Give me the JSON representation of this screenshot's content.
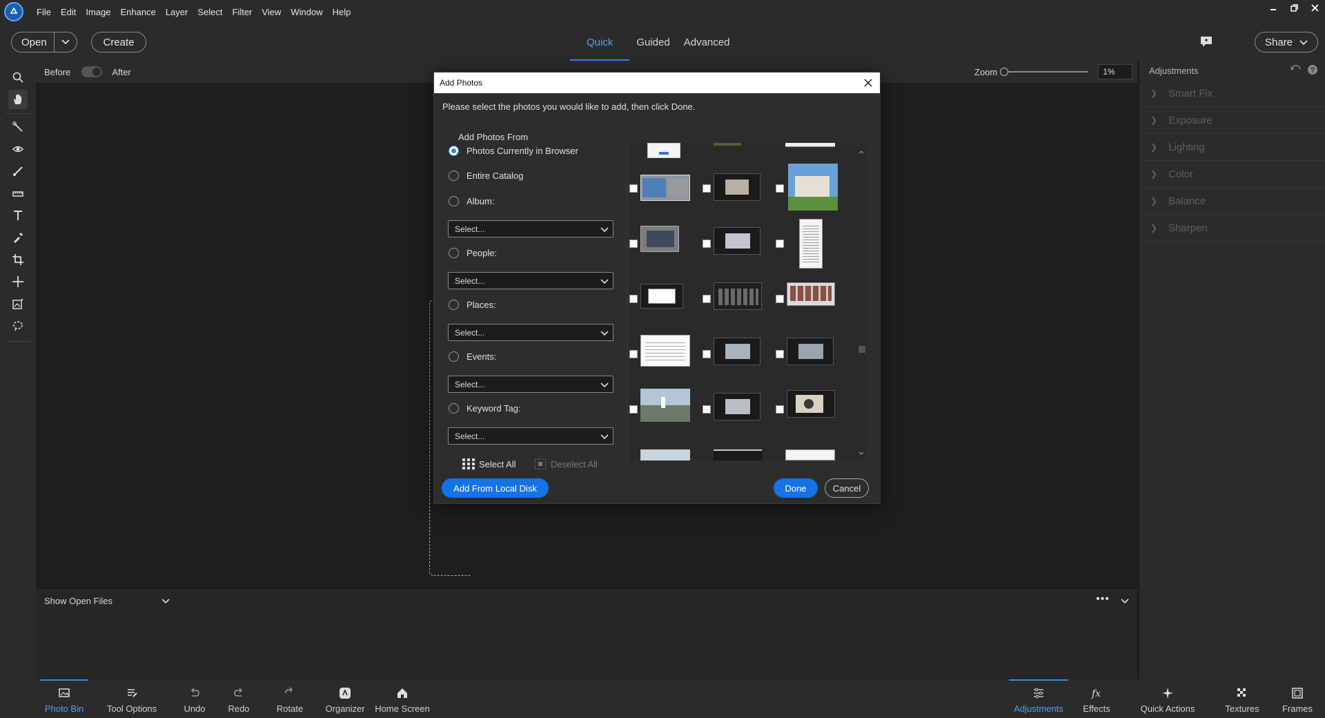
{
  "menubar": {
    "items": [
      "File",
      "Edit",
      "Image",
      "Enhance",
      "Layer",
      "Select",
      "Filter",
      "View",
      "Window",
      "Help"
    ]
  },
  "toolbar": {
    "open_label": "Open",
    "create_label": "Create",
    "tabs": [
      "Quick",
      "Guided",
      "Advanced"
    ],
    "active_tab": "Quick",
    "share_label": "Share"
  },
  "subbar": {
    "before_label": "Before",
    "after_label": "After",
    "zoom_label": "Zoom",
    "zoom_value": "1%"
  },
  "adjustments": {
    "title": "Adjustments",
    "items": [
      "Smart Fix",
      "Exposure",
      "Lighting",
      "Color",
      "Balance",
      "Sharpen"
    ]
  },
  "bin": {
    "dropdown_label": "Show Open Files"
  },
  "bottombar": {
    "left": [
      "Photo Bin",
      "Tool Options",
      "Undo",
      "Redo",
      "Rotate",
      "Organizer",
      "Home Screen"
    ],
    "right": [
      "Adjustments",
      "Effects",
      "Quick Actions",
      "Textures",
      "Frames"
    ]
  },
  "dialog": {
    "title": "Add Photos",
    "description": "Please select the photos you would like to add, then click Done.",
    "from_heading": "Add Photos From",
    "options": [
      "Photos Currently in Browser",
      "Entire Catalog",
      "Album:",
      "People:",
      "Places:",
      "Events:",
      "Keyword Tag:"
    ],
    "selected_option": "Photos Currently in Browser",
    "select_placeholder": "Select...",
    "select_all_label": "Select All",
    "deselect_all_label": "Deselect All",
    "add_local_label": "Add From Local Disk",
    "done_label": "Done",
    "cancel_label": "Cancel"
  },
  "colors": {
    "accent": "#1473e6",
    "tab_active": "#4aa3ff",
    "panel_bg": "#2b2b2b",
    "canvas_bg": "#1e1e1e"
  }
}
